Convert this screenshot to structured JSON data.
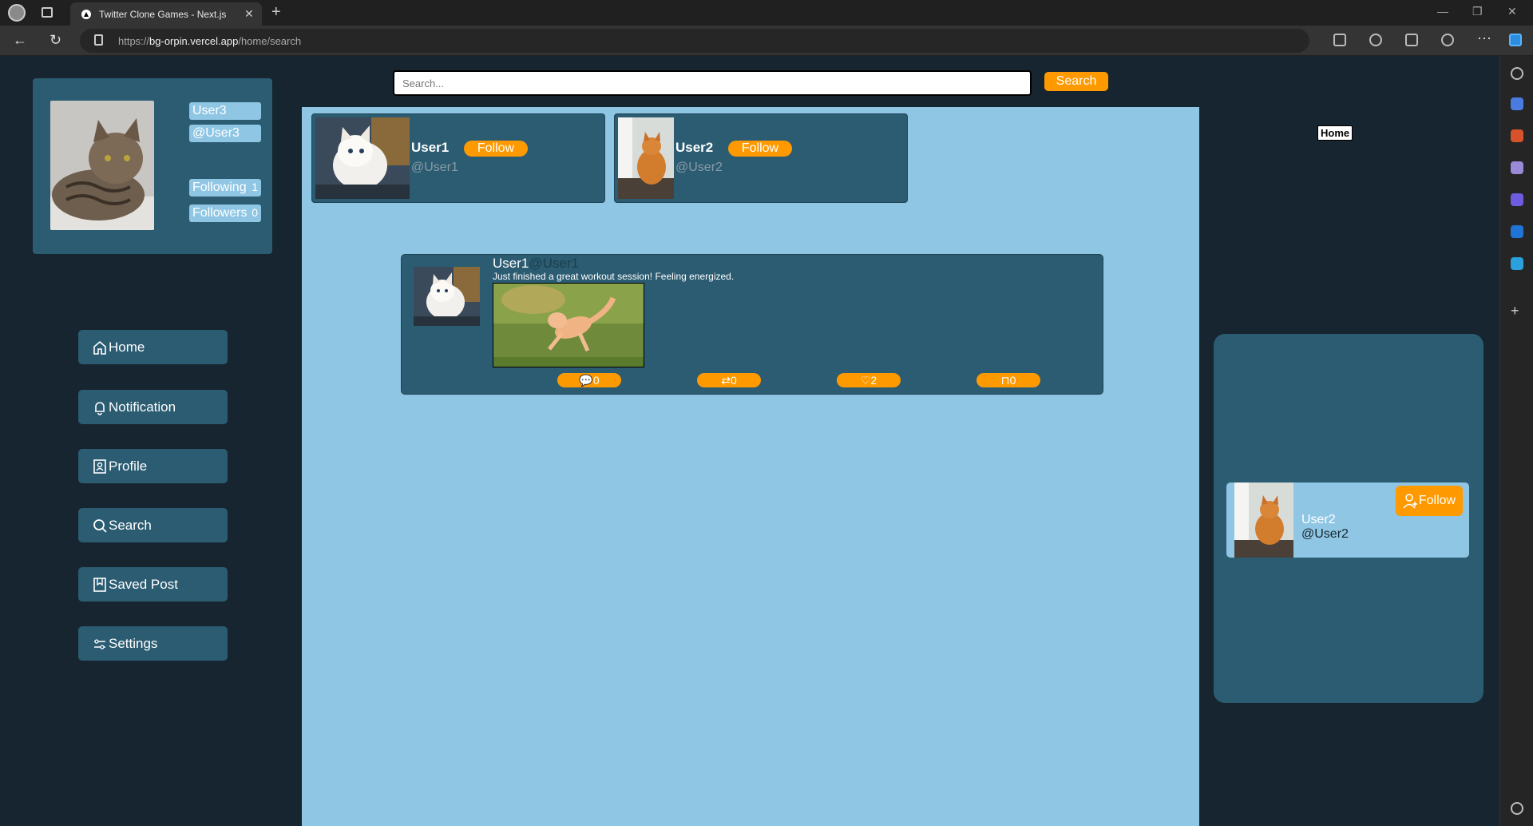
{
  "browser": {
    "tab_title": "Twitter Clone Games - Next.js",
    "url_scheme": "https://",
    "url_host": "bg-orpin.vercel.app",
    "url_path": "/home/search"
  },
  "me": {
    "name": "User3",
    "handle": "@User3",
    "following_label": "Following",
    "following_count": "1",
    "followers_label": "Followers",
    "followers_count": "0"
  },
  "nav": {
    "home": "Home",
    "notification": "Notification",
    "profile": "Profile",
    "search": "Search",
    "saved": "Saved Post",
    "settings": "Settings"
  },
  "search": {
    "placeholder": "Search...",
    "button": "Search"
  },
  "results": [
    {
      "name": "User1",
      "handle": "@User1",
      "follow": "Follow"
    },
    {
      "name": "User2",
      "handle": "@User2",
      "follow": "Follow"
    }
  ],
  "post": {
    "name": "User1",
    "handle": "@User1",
    "text": "Just finished a great workout session! Feeling energized.",
    "comments": "0",
    "retweets": "0",
    "likes": "2",
    "saves": "0"
  },
  "right": {
    "home_tag": "Home",
    "suggestion": {
      "name": "User2",
      "handle": "@User2",
      "follow": "Follow"
    }
  },
  "colors": {
    "page_bg": "#172530",
    "card": "#2b5c72",
    "light": "#8fc6e4",
    "accent": "#ff9900"
  }
}
